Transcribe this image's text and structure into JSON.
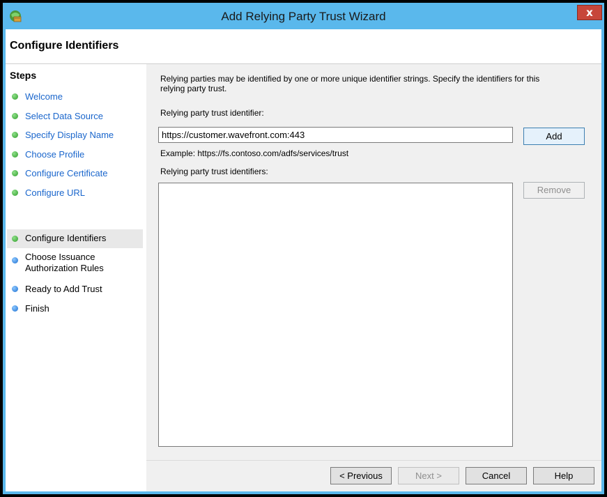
{
  "window": {
    "title": "Add Relying Party Trust Wizard",
    "close_label": "x"
  },
  "header": {
    "title": "Configure Identifiers"
  },
  "steps": {
    "title": "Steps",
    "items": [
      {
        "label": "Welcome",
        "state": "done"
      },
      {
        "label": "Select Data Source",
        "state": "done"
      },
      {
        "label": "Specify Display Name",
        "state": "done"
      },
      {
        "label": "Choose Profile",
        "state": "done"
      },
      {
        "label": "Configure Certificate",
        "state": "done"
      },
      {
        "label": "Configure URL",
        "state": "done"
      },
      {
        "label": "Configure Identifiers",
        "state": "current"
      },
      {
        "label": "Choose Issuance",
        "label2": "Authorization Rules",
        "state": "pending"
      },
      {
        "label": "Ready to Add Trust",
        "state": "pending"
      },
      {
        "label": "Finish",
        "state": "pending"
      }
    ]
  },
  "main": {
    "description_line1": "Relying parties may be identified by one or more unique identifier strings. Specify the identifiers for this",
    "description_line2": "relying party trust.",
    "identifier_label": "Relying party trust identifier:",
    "identifier_value": "https://customer.wavefront.com:443",
    "add_label": "Add",
    "example": "Example: https://fs.contoso.com/adfs/services/trust",
    "identifiers_label": "Relying party trust identifiers:",
    "identifiers": [],
    "remove_label": "Remove"
  },
  "footer": {
    "previous_label": "< Previous",
    "next_label": "Next >",
    "cancel_label": "Cancel",
    "help_label": "Help"
  },
  "colors": {
    "title_bar": "#5ab8ec",
    "link": "#1a66cc",
    "step_done": "#2f9d2a",
    "step_pending": "#1b6fd1",
    "close_button": "#c7463a"
  }
}
